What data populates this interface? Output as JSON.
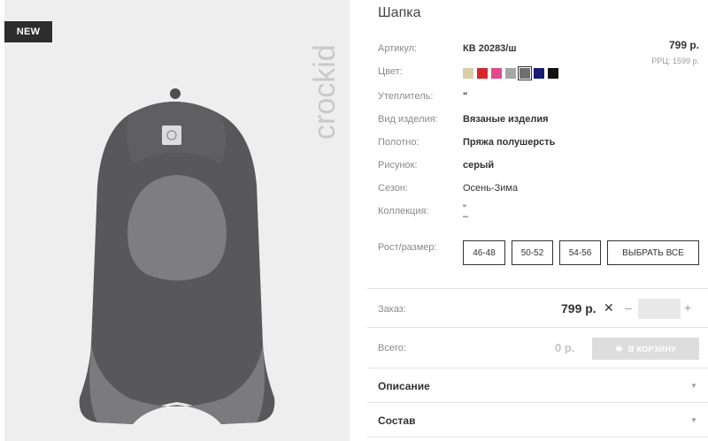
{
  "badge": "NEW",
  "brand_logo_text": "crockid",
  "product": {
    "title": "Шапка",
    "price": "799 р.",
    "rrp": "РРЦ: 1599 р."
  },
  "attributes": [
    {
      "label": "Артикул:",
      "value": "КВ 20283/ш"
    },
    {
      "label": "Цвет:",
      "value": ""
    },
    {
      "label": "Утеплитель:",
      "value": "\""
    },
    {
      "label": "Вид изделия:",
      "value": "Вязаные изделия"
    },
    {
      "label": "Полотно:",
      "value": "Пряжа полушерсть"
    },
    {
      "label": "Рисунок:",
      "value": "серый"
    },
    {
      "label": "Сезон:",
      "value": "Осень-Зима"
    },
    {
      "label": "Коллекция:",
      "value": "\""
    },
    {
      "label": "Рост/размер:",
      "value": ""
    }
  ],
  "collection_extra": "–",
  "colors": [
    "#d8cda8",
    "#d6262b",
    "#e24a87",
    "#a6a6a6",
    "#6f6f6f",
    "#1b1b7a",
    "#111111"
  ],
  "selected_color_index": 4,
  "sizes": [
    "46-48",
    "50-52",
    "54-56"
  ],
  "select_all_label": "ВЫБРАТЬ ВСЕ",
  "order": {
    "label": "Заказ:",
    "price": "799 р.",
    "times": "✕",
    "minus": "–",
    "plus": "+",
    "qty": ""
  },
  "total": {
    "label": "Всего:",
    "price": "0 р.",
    "cart_label": "В КОРЗИНУ"
  },
  "accordions": [
    {
      "title": "Описание"
    },
    {
      "title": "Состав"
    }
  ],
  "arrow_glyph": "▼"
}
